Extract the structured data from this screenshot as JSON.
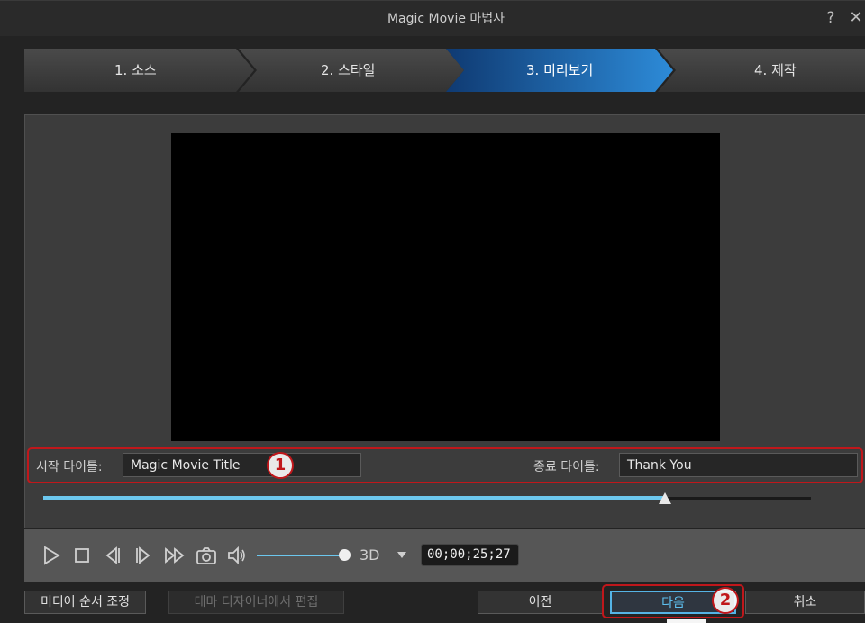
{
  "window": {
    "title": "Magic Movie 마법사",
    "help_icon": "?",
    "close_icon": "✕"
  },
  "steps": [
    {
      "label": "1. 소스"
    },
    {
      "label": "2. 스타일"
    },
    {
      "label": "3. 미리보기"
    },
    {
      "label": "4. 제작"
    }
  ],
  "titles": {
    "start_label": "시작 타이틀:",
    "start_value": "Magic Movie Title",
    "end_label": "종료 타이틀:",
    "end_value": "Thank You",
    "marker_1": "1",
    "marker_2": "2"
  },
  "playback": {
    "progress": 0.81,
    "volume": 1.0,
    "label_3d": "3D",
    "timecode": "00;00;25;27"
  },
  "buttons": {
    "media_order": "미디어 순서 조정",
    "theme_designer": "테마 디자이너에서 편집",
    "prev": "이전",
    "next": "다음",
    "cancel": "취소"
  },
  "colors": {
    "accent": "#55b4e6",
    "highlight": "#c0171b",
    "active_step": "#1d6fc0"
  }
}
